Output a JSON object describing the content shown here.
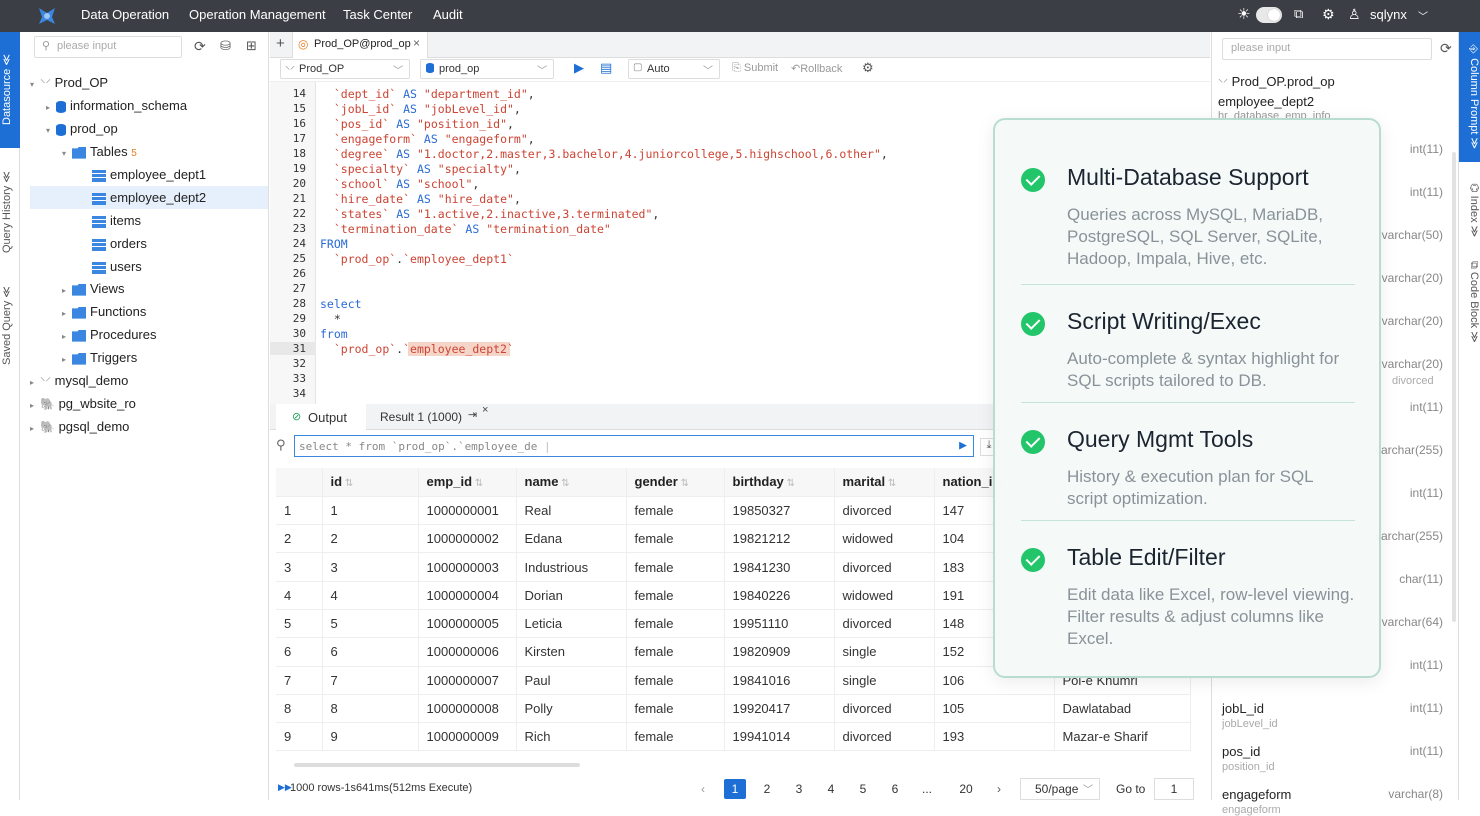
{
  "topbar": {
    "nav": [
      "Data Operation",
      "Operation Management",
      "Task Center",
      "Audit"
    ],
    "user": "sqlynx"
  },
  "leftrail": {
    "tabs": [
      "Datasource",
      "Query History",
      "Saved Query"
    ]
  },
  "sidebar": {
    "search_placeholder": "please input",
    "tree": {
      "conn1": "Prod_OP",
      "db1": "information_schema",
      "db2": "prod_op",
      "tables_label": "Tables",
      "tables_count": "5",
      "tables": [
        "employee_dept1",
        "employee_dept2",
        "items",
        "orders",
        "users"
      ],
      "folders": [
        "Views",
        "Functions",
        "Procedures",
        "Triggers"
      ],
      "conns": [
        "mysql_demo",
        "pg_wbsite_ro",
        "pgsql_demo"
      ]
    }
  },
  "editor_tabs": {
    "add": "+",
    "tab": "Prod_OP@prod_op",
    "close": "×"
  },
  "toolbar": {
    "conn": "Prod_OP",
    "db": "prod_op",
    "mode": "Auto",
    "submit": "Submit",
    "rollback": "Rollback"
  },
  "editor": {
    "lines": [
      {
        "n": "14",
        "a": "  `dept_id` AS \"department_id\","
      },
      {
        "n": "15",
        "a": "  `jobL_id` AS \"jobLevel_id\","
      },
      {
        "n": "16",
        "a": "  `pos_id` AS \"position_id\","
      },
      {
        "n": "17",
        "a": "  `engageform` AS \"engageform\","
      },
      {
        "n": "18",
        "a": "  `degree` AS \"1.doctor,2.master,3.bachelor,4.juniorcollege,5.highschool,6.other\","
      },
      {
        "n": "19",
        "a": "  `specialty` AS \"specialty\","
      },
      {
        "n": "20",
        "a": "  `school` AS \"school\","
      },
      {
        "n": "21",
        "a": "  `hire_date` AS \"hire_date\","
      },
      {
        "n": "22",
        "a": "  `states` AS \"1.active,2.inactive,3.terminated\","
      },
      {
        "n": "23",
        "a": "  `termination_date` AS \"termination_date\""
      },
      {
        "n": "24",
        "a": "FROM"
      },
      {
        "n": "25",
        "a": "  `prod_op`.`employee_dept1`"
      },
      {
        "n": "26",
        "a": ""
      },
      {
        "n": "27",
        "a": ""
      },
      {
        "n": "28",
        "a": "select"
      },
      {
        "n": "29",
        "a": "  *"
      },
      {
        "n": "30",
        "a": "from"
      },
      {
        "n": "31",
        "a": "  `prod_op`.`employee_dept2`"
      },
      {
        "n": "32",
        "a": ""
      },
      {
        "n": "33",
        "a": ""
      },
      {
        "n": "34",
        "a": ""
      }
    ]
  },
  "results": {
    "tab_output": "Output",
    "tab_result": "Result 1 (1000)",
    "sql": "select * from `prod_op`.`employee_de",
    "columns": [
      "id",
      "emp_id",
      "name",
      "gender",
      "birthday",
      "marital",
      "nation_i",
      ""
    ],
    "rows": [
      [
        "1",
        "1",
        "1000000001",
        "Real",
        "female",
        "19850327",
        "divorced",
        "147",
        ""
      ],
      [
        "2",
        "2",
        "1000000002",
        "Edana",
        "female",
        "19821212",
        "widowed",
        "104",
        ""
      ],
      [
        "3",
        "3",
        "1000000003",
        "Industrious",
        "female",
        "19841230",
        "divorced",
        "183",
        ""
      ],
      [
        "4",
        "4",
        "1000000004",
        "Dorian",
        "female",
        "19840226",
        "widowed",
        "191",
        ""
      ],
      [
        "5",
        "5",
        "1000000005",
        "Leticia",
        "female",
        "19951110",
        "divorced",
        "148",
        ""
      ],
      [
        "6",
        "6",
        "1000000006",
        "Kirsten",
        "female",
        "19820909",
        "single",
        "152",
        ""
      ],
      [
        "7",
        "7",
        "1000000007",
        "Paul",
        "female",
        "19841016",
        "single",
        "106",
        "Pol-e Khumri"
      ],
      [
        "8",
        "8",
        "1000000008",
        "Polly",
        "female",
        "19920417",
        "divorced",
        "105",
        "Dawlatabad"
      ],
      [
        "9",
        "9",
        "1000000009",
        "Rich",
        "female",
        "19941014",
        "divorced",
        "193",
        "Mazar-e Sharif"
      ]
    ],
    "status": "1000 rows-1s641ms(512ms Execute)",
    "pages": [
      "1",
      "2",
      "3",
      "4",
      "5",
      "6",
      "...",
      "20"
    ],
    "page_size": "50/page",
    "goto_label": "Go to",
    "goto_value": "1"
  },
  "rightpanel": {
    "search_placeholder": "please input",
    "path": "Prod_OP.prod_op",
    "table": "employee_dept2",
    "table_comment": "hr_database_emp_info",
    "columns": [
      {
        "name": "",
        "type": "int(11)",
        "comment": ""
      },
      {
        "name": "",
        "type": "int(11)",
        "comment": ""
      },
      {
        "name": "",
        "type": "varchar(50)",
        "comment": ""
      },
      {
        "name": "",
        "type": "varchar(20)",
        "comment": ""
      },
      {
        "name": "",
        "type": "varchar(20)",
        "comment": ""
      },
      {
        "name": "",
        "type": "varchar(20)",
        "comment": "divorced"
      },
      {
        "name": "",
        "type": "int(11)",
        "comment": ""
      },
      {
        "name": "",
        "type": "varchar(255)",
        "comment": ""
      },
      {
        "name": "",
        "type": "int(11)",
        "comment": ""
      },
      {
        "name": "",
        "type": "varchar(255)",
        "comment": ""
      },
      {
        "name": "",
        "type": "char(11)",
        "comment": ""
      },
      {
        "name": "",
        "type": "varchar(64)",
        "comment": ""
      },
      {
        "name": "",
        "type": "int(11)",
        "comment": ""
      },
      {
        "name": "jobL_id",
        "type": "int(11)",
        "comment": "jobLevel_id"
      },
      {
        "name": "pos_id",
        "type": "int(11)",
        "comment": "position_id"
      },
      {
        "name": "engageform",
        "type": "varchar(8)",
        "comment": "engageform"
      }
    ]
  },
  "rightrail": {
    "tabs": [
      "Column Prompt",
      "Index",
      "Code Block"
    ]
  },
  "card": {
    "features": [
      {
        "title": "Multi-Database Support",
        "desc": "Queries across MySQL, MariaDB, PostgreSQL, SQL Server, SQLite, Hadoop, Impala, Hive, etc."
      },
      {
        "title": "Script Writing/Exec",
        "desc": "Auto-complete & syntax highlight for SQL scripts tailored to DB."
      },
      {
        "title": "Query Mgmt Tools",
        "desc": "History & execution plan for SQL script optimization."
      },
      {
        "title": "Table Edit/Filter",
        "desc": "Edit data like Excel, row-level viewing. Filter results & adjust columns like Excel."
      }
    ]
  }
}
